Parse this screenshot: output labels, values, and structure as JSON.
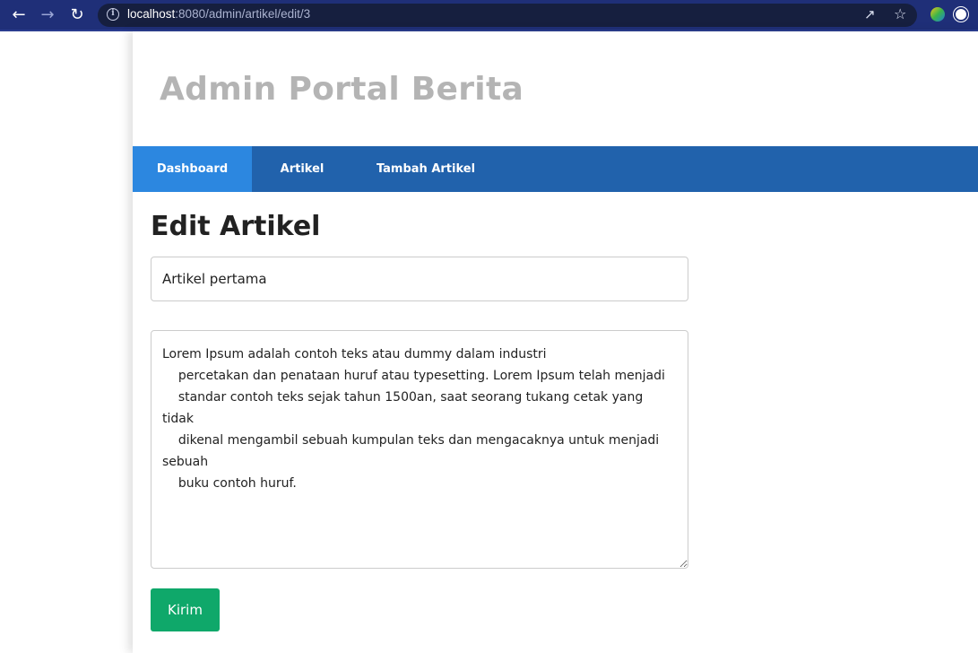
{
  "browser": {
    "url_host": "localhost",
    "url_rest": ":8080/admin/artikel/edit/3"
  },
  "site": {
    "title": "Admin Portal Berita"
  },
  "nav": {
    "items": [
      {
        "label": "Dashboard",
        "active": true
      },
      {
        "label": "Artikel",
        "active": false
      },
      {
        "label": "Tambah Artikel",
        "active": false
      }
    ]
  },
  "form": {
    "heading": "Edit Artikel",
    "title_value": "Artikel pertama",
    "content_value": "Lorem Ipsum adalah contoh teks atau dummy dalam industri\n    percetakan dan penataan huruf atau typesetting. Lorem Ipsum telah menjadi\n    standar contoh teks sejak tahun 1500an, saat seorang tukang cetak yang tidak\n    dikenal mengambil sebuah kumpulan teks dan mengacaknya untuk menjadi sebuah\n    buku contoh huruf.",
    "submit_label": "Kirim"
  },
  "colors": {
    "nav_bg": "#2162ac",
    "nav_active": "#2c87e0",
    "submit_bg": "#0fa86a"
  },
  "icons": [
    "back-arrow-icon",
    "forward-arrow-icon",
    "reload-icon",
    "info-icon",
    "share-icon",
    "star-icon",
    "extension-icon",
    "profile-icon"
  ]
}
